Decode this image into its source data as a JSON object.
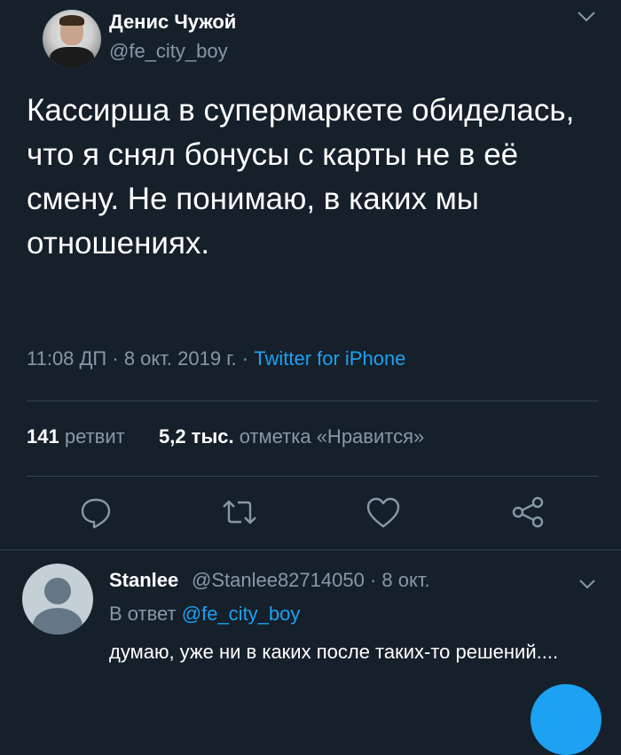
{
  "tweet": {
    "author_name": "Денис Чужой",
    "author_handle": "@fe_city_boy",
    "text": "Кассирша в супермаркете обиделась, что я снял бонусы с карты не в её смену. Не понимаю, в каких мы отношениях.",
    "time": "11:08 ДП",
    "sep": "·",
    "date": "8 окт. 2019 г.",
    "source": "Twitter for iPhone",
    "retweets_count": "141",
    "retweets_label": "ретвит",
    "likes_count": "5,2 тыс.",
    "likes_label": "отметка «Нравится»"
  },
  "actions": {
    "icons": [
      "reply-icon",
      "retweet-icon",
      "like-icon",
      "share-icon"
    ]
  },
  "reply": {
    "author_name": "Stanlee",
    "author_handle": "@Stanlee82714050",
    "sep": "·",
    "date": "8 окт.",
    "reply_prefix": "В ответ",
    "reply_to": "@fe_city_boy",
    "text": "думаю, уже ни в каких после таких-то решений...."
  },
  "colors": {
    "background": "#15202b",
    "text": "#ffffff",
    "secondary": "#8899a6",
    "accent": "#1da1f2",
    "divider": "#38444d"
  }
}
